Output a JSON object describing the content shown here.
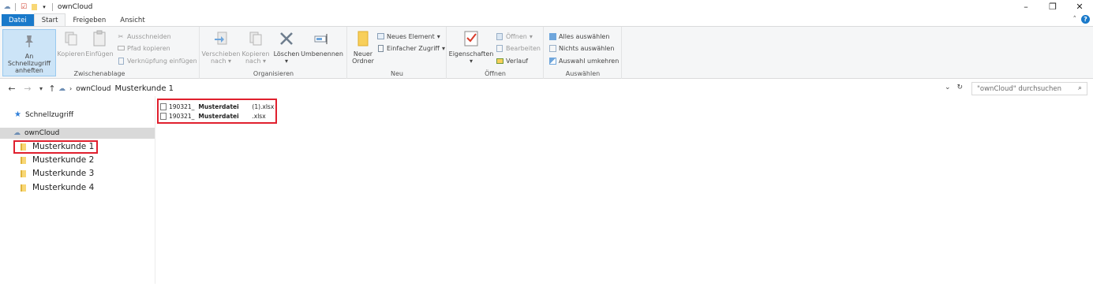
{
  "window": {
    "title": "ownCloud"
  },
  "tabs": {
    "file": "Datei",
    "start": "Start",
    "share": "Freigeben",
    "view": "Ansicht"
  },
  "ribbon": {
    "clipboard": {
      "label": "Zwischenablage",
      "pin_line1": "An Schnellzugriff",
      "pin_line2": "anheften",
      "copy": "Kopieren",
      "paste": "Einfügen",
      "cut": "Ausschneiden",
      "copy_path": "Pfad kopieren",
      "paste_shortcut": "Verknüpfung einfügen"
    },
    "organize": {
      "label": "Organisieren",
      "move_line1": "Verschieben",
      "move_line2": "nach",
      "copyto_line1": "Kopieren",
      "copyto_line2": "nach",
      "delete": "Löschen",
      "rename": "Umbenennen"
    },
    "new": {
      "label": "Neu",
      "folder_line1": "Neuer",
      "folder_line2": "Ordner",
      "new_item": "Neues Element",
      "easy_access": "Einfacher Zugriff"
    },
    "open": {
      "label": "Öffnen",
      "properties": "Eigenschaften",
      "open": "Öffnen",
      "edit": "Bearbeiten",
      "history": "Verlauf"
    },
    "select": {
      "label": "Auswählen",
      "select_all": "Alles auswählen",
      "select_none": "Nichts auswählen",
      "invert": "Auswahl umkehren"
    }
  },
  "address": {
    "crumb_root": "ownCloud",
    "crumb_current": "Musterkunde 1",
    "search_placeholder": "\"ownCloud\" durchsuchen"
  },
  "nav": {
    "quick_access": "Schnellzugriff",
    "owncloud": "ownCloud",
    "folders": [
      "Musterkunde 1",
      "Musterkunde 2",
      "Musterkunde 3",
      "Musterkunde 4"
    ]
  },
  "files": [
    {
      "prefix": "190321_",
      "name": "Musterdatei",
      "suffix": "(1).xlsx"
    },
    {
      "prefix": "190321_",
      "name": "Musterdatei",
      "suffix": ".xlsx"
    }
  ],
  "colors": {
    "accent": "#1979ca",
    "highlight_box": "#e0202e",
    "selected_nav": "#d9d9d9"
  }
}
